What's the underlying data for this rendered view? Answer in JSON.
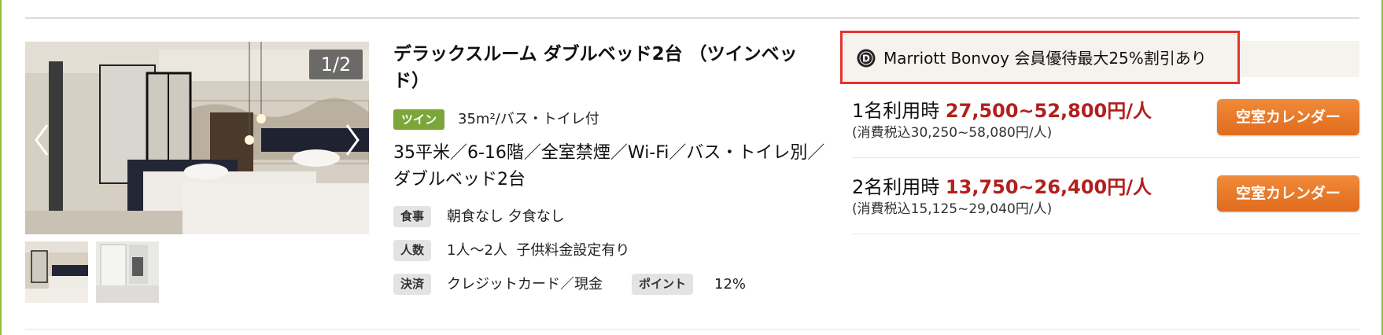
{
  "gallery": {
    "counter": "1/2",
    "thumbnails": [
      "room-photo-1",
      "room-photo-2"
    ]
  },
  "room": {
    "title": "デラックスルーム ダブルベッド2台 （ツインベッド）",
    "type_tag": "ツイン",
    "size_text": "35m²/バス・トイレ付",
    "description": "35平米／6-16階／全室禁煙／Wi-Fi／バス・トイレ別／ダブルベッド2台"
  },
  "details": {
    "meal": {
      "label": "食事",
      "value": "朝食なし 夕食なし"
    },
    "people": {
      "label": "人数",
      "value": "1人～2人  子供料金設定有り"
    },
    "payment": {
      "label": "決済",
      "value": "クレジットカード／現金"
    },
    "points": {
      "label": "ポイント",
      "value": "12%"
    }
  },
  "bonvoy": {
    "icon": "marriott-bonvoy-logo-icon",
    "text": "Marriott Bonvoy 会員優待最大25%割引あり"
  },
  "prices": [
    {
      "people": "1名利用時",
      "range": "27,500~52,800円/人",
      "tax": "(消費税込30,250~58,080円/人)",
      "button": "空室カレンダー"
    },
    {
      "people": "2名利用時",
      "range": "13,750~26,400円/人",
      "tax": "(消費税込15,125~29,040円/人)",
      "button": "空室カレンダー"
    }
  ],
  "colors": {
    "frame_green": "#8fbf3a",
    "tag_green": "#7aa63a",
    "price_red": "#b2201d",
    "highlight_red": "#e5342a",
    "button_orange": "#e87a2a"
  }
}
